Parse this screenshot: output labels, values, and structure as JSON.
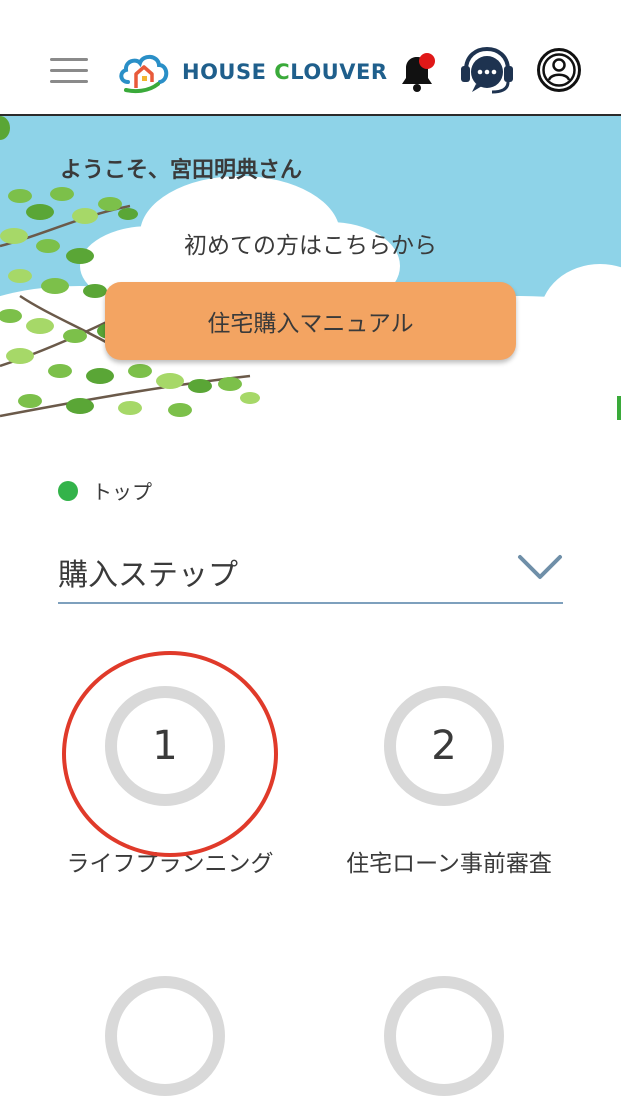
{
  "header": {
    "logo": {
      "part1": "HOUSE ",
      "part2": "C",
      "part3": "LOUVER"
    },
    "notification_dot_color": "#e01818"
  },
  "banner": {
    "welcome": "ようこそ、宮田明典さん",
    "first_time": "初めての方はこちらから",
    "manual_button": "住宅購入マニュアル"
  },
  "breadcrumb": {
    "label": "トップ"
  },
  "step_select": {
    "label": "購入ステップ"
  },
  "steps": [
    {
      "number": "1",
      "label": "ライフプランニング"
    },
    {
      "number": "2",
      "label": "住宅ローン事前審査"
    }
  ],
  "colors": {
    "accent_orange": "#f3a462",
    "breadcrumb_dot": "#33b34a",
    "annotation_red": "#e03a2a",
    "sky": "#8ed3e8"
  }
}
